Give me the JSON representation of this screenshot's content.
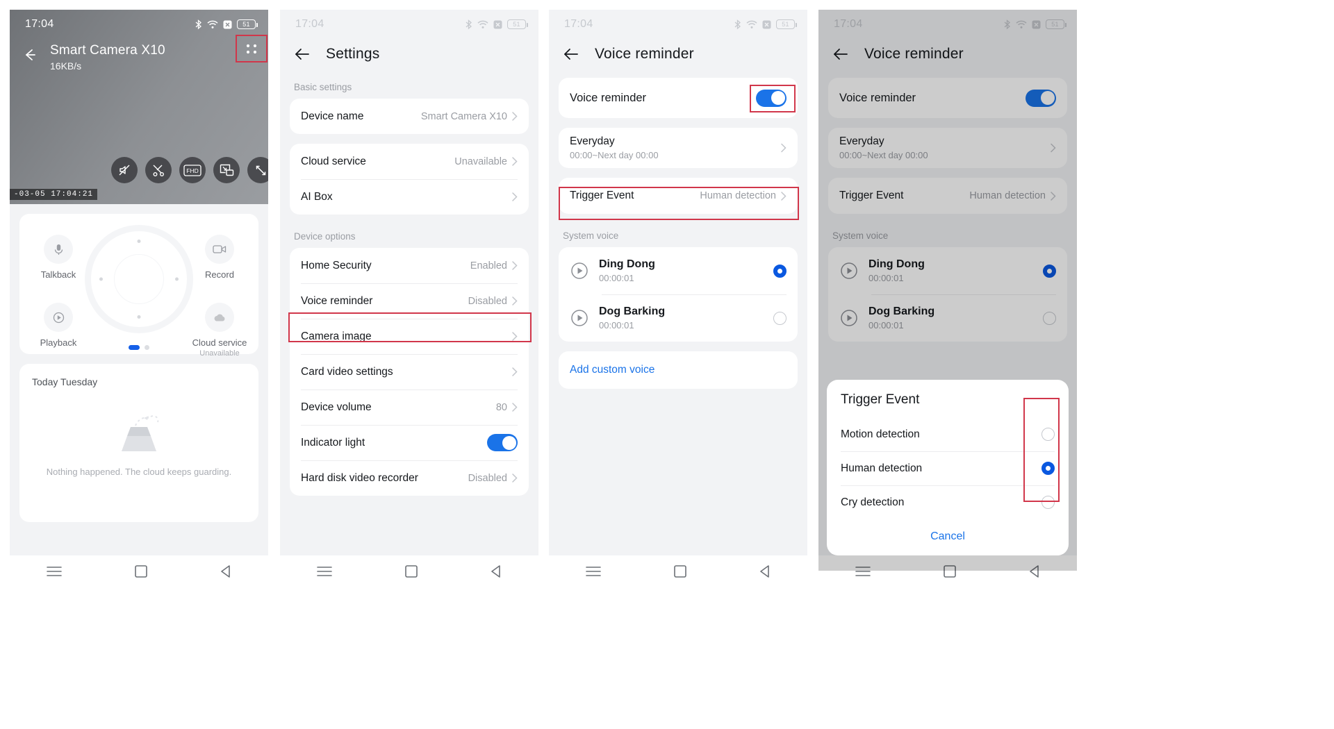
{
  "status_bar": {
    "time": "17:04",
    "battery": "51",
    "icons": [
      "bluetooth-icon",
      "wifi-icon",
      "mute-badge-icon",
      "battery-icon"
    ]
  },
  "panel1": {
    "back_icon": "back-arrow-icon",
    "title": "Smart Camera X10",
    "bitrate": "16KB/s",
    "menu_icon": "grid-menu-icon",
    "video_controls": [
      {
        "name": "mute-icon"
      },
      {
        "name": "snapshot-icon"
      },
      {
        "name": "fhd-quality-icon",
        "label": "FHD"
      },
      {
        "name": "picture-in-picture-icon"
      },
      {
        "name": "fullscreen-icon"
      }
    ],
    "timestamp": "-03-05  17:04:21",
    "functions": [
      {
        "label": "Talkback",
        "sub": "",
        "icon": "microphone-icon"
      },
      {
        "label": "Record",
        "sub": "",
        "icon": "video-camera-icon"
      },
      {
        "label": "Playback",
        "sub": "",
        "icon": "playback-icon"
      },
      {
        "label": "Cloud service",
        "sub": "Unavailable",
        "icon": "cloud-icon"
      }
    ],
    "page_dots": 2,
    "events": {
      "title": "Today Tuesday",
      "empty_text": "Nothing happened. The cloud keeps guarding."
    }
  },
  "panel2": {
    "back_icon": "back-arrow-icon",
    "title": "Settings",
    "sections": [
      {
        "header": "Basic settings",
        "groups": [
          [
            {
              "label": "Device name",
              "value": "Smart Camera X10",
              "chevron": true
            }
          ],
          [
            {
              "label": "Cloud service",
              "value": "Unavailable",
              "chevron": true
            },
            {
              "label": "AI Box",
              "value": "",
              "chevron": true
            }
          ]
        ]
      },
      {
        "header": "Device options",
        "groups": [
          [
            {
              "label": "Home Security",
              "value": "Enabled",
              "chevron": true
            },
            {
              "label": "Voice reminder",
              "value": "Disabled",
              "chevron": true,
              "highlighted": true
            },
            {
              "label": "Camera image",
              "value": "",
              "chevron": true
            },
            {
              "label": "Card video settings",
              "value": "",
              "chevron": true
            },
            {
              "label": "Device volume",
              "value": "80",
              "chevron": true
            },
            {
              "label": "Indicator light",
              "value": "",
              "toggle": true,
              "toggle_on": true
            },
            {
              "label": "Hard disk video recorder",
              "value": "Disabled",
              "chevron": true
            }
          ]
        ]
      }
    ]
  },
  "panel3": {
    "back_icon": "back-arrow-icon",
    "title": "Voice reminder",
    "toggle_row": {
      "label": "Voice reminder",
      "toggle_on": true,
      "highlighted": true
    },
    "schedule_row": {
      "label": "Everyday",
      "sub": "00:00~Next day 00:00",
      "chevron": true
    },
    "trigger_row": {
      "label": "Trigger Event",
      "value": "Human detection",
      "chevron": true,
      "highlighted": true
    },
    "system_voice_header": "System voice",
    "voices": [
      {
        "name": "Ding Dong",
        "duration": "00:00:01",
        "selected": true
      },
      {
        "name": "Dog Barking",
        "duration": "00:00:01",
        "selected": false
      }
    ],
    "add_custom_voice": "Add custom voice"
  },
  "panel4": {
    "back_icon": "back-arrow-icon",
    "title": "Voice reminder",
    "toggle_row": {
      "label": "Voice reminder",
      "toggle_on": true
    },
    "schedule_row": {
      "label": "Everyday",
      "sub": "00:00~Next day 00:00",
      "chevron": true
    },
    "trigger_row": {
      "label": "Trigger Event",
      "value": "Human detection",
      "chevron": true
    },
    "system_voice_header": "System voice",
    "voices": [
      {
        "name": "Ding Dong",
        "duration": "00:00:01",
        "selected": true
      },
      {
        "name": "Dog Barking",
        "duration": "00:00:01",
        "selected": false
      }
    ],
    "dialog": {
      "title": "Trigger Event",
      "options": [
        {
          "label": "Motion detection",
          "selected": false
        },
        {
          "label": "Human detection",
          "selected": true
        },
        {
          "label": "Cry detection",
          "selected": false
        }
      ],
      "cancel": "Cancel"
    }
  },
  "nav_bar": {
    "menu_icon": "menu-icon",
    "home_icon": "home-square-icon",
    "back_icon": "back-triangle-icon"
  },
  "colors": {
    "accent": "#1a73e8",
    "radio_on": "#0a58e0",
    "annotation": "#d1364a",
    "bg": "#f2f3f5"
  }
}
